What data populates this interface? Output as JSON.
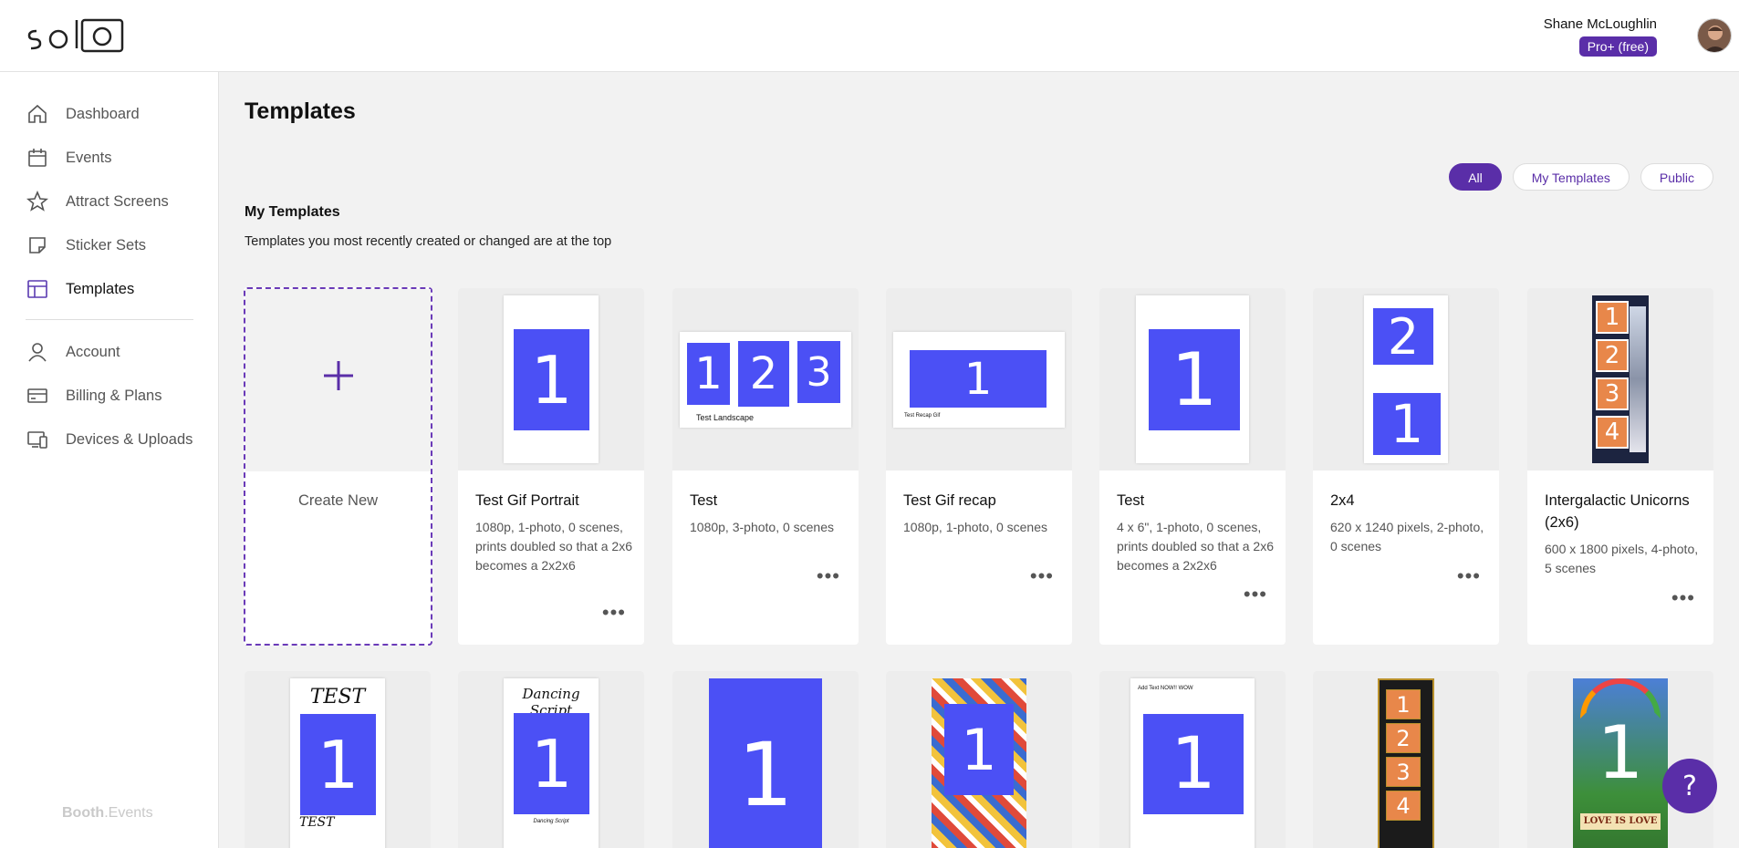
{
  "app": {
    "logo_text": "SOLO",
    "brand_footer_bold": "Booth",
    "brand_footer_light": ".Events"
  },
  "user": {
    "name": "Shane McLoughlin",
    "plan": "Pro+ (free)"
  },
  "sidebar": {
    "items": [
      {
        "label": "Dashboard",
        "icon": "home-icon"
      },
      {
        "label": "Events",
        "icon": "calendar-icon"
      },
      {
        "label": "Attract Screens",
        "icon": "star-icon"
      },
      {
        "label": "Sticker Sets",
        "icon": "sticker-icon"
      },
      {
        "label": "Templates",
        "icon": "template-icon"
      },
      {
        "label": "Account",
        "icon": "user-icon"
      },
      {
        "label": "Billing & Plans",
        "icon": "card-icon"
      },
      {
        "label": "Devices & Uploads",
        "icon": "devices-icon"
      }
    ]
  },
  "main": {
    "title": "Templates",
    "filters": [
      "All",
      "My Templates",
      "Public"
    ],
    "section_title": "My Templates",
    "section_subtitle": "Templates you most recently created or changed are at the top",
    "create_label": "Create New",
    "cards": [
      {
        "name": "Test Gif Portrait",
        "desc": "1080p, 1-photo, 0 scenes, prints doubled so that a 2x6 becomes a 2x2x6"
      },
      {
        "name": "Test",
        "desc": "1080p, 3-photo, 0 scenes",
        "thumb_label": "Test Landscape"
      },
      {
        "name": "Test Gif recap",
        "desc": "1080p, 1-photo, 0 scenes",
        "thumb_label": "Test Recap Gif"
      },
      {
        "name": "Test",
        "desc": "4 x 6\", 1-photo, 0 scenes, prints doubled so that a 2x6 becomes a 2x2x6"
      },
      {
        "name": "2x4",
        "desc": "620 x 1240 pixels, 2-photo, 0 scenes"
      },
      {
        "name": "Intergalactic Unicorns (2x6)",
        "desc": "600 x 1800 pixels, 4-photo, 5 scenes"
      }
    ],
    "row2": [
      {
        "top_text": "TEST",
        "bottom_text": "TEST"
      },
      {
        "top_text": "Dancing Script",
        "bottom_text": "Dancing Script"
      },
      {},
      {},
      {
        "top_text": "Add Text NOW!! WOW"
      },
      {},
      {
        "bottom_text": "LOVE IS LOVE"
      }
    ],
    "more_label": "•••"
  },
  "numbers": {
    "one": "1",
    "two": "2",
    "three": "3",
    "four": "4"
  },
  "help": {
    "label": "?"
  },
  "colors": {
    "accent": "#5a2ea8",
    "photo_blue": "#4b50f5",
    "orange": "#e8874a"
  }
}
